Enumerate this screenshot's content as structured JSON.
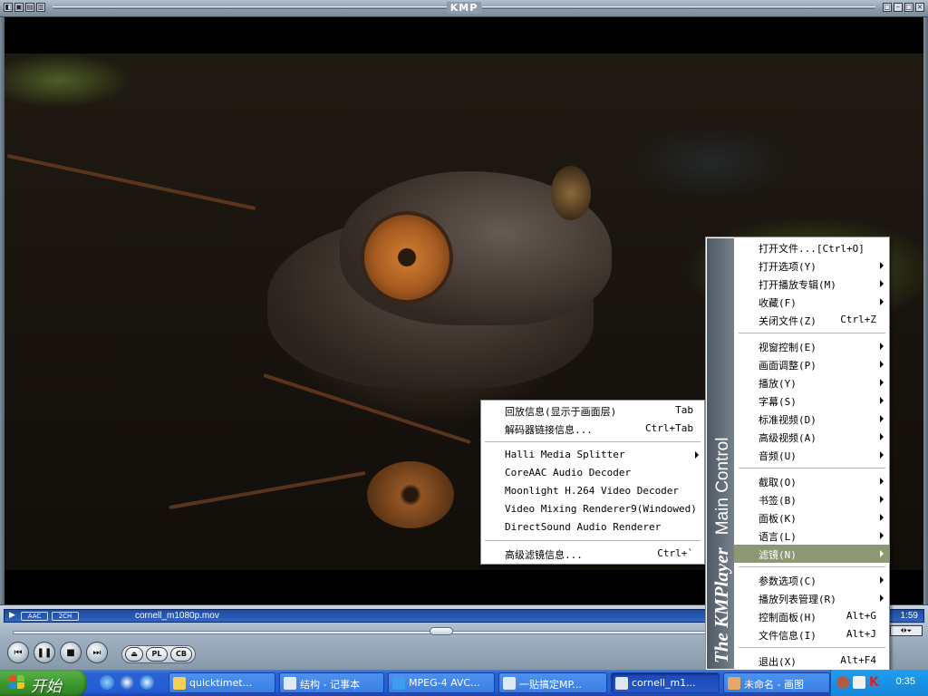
{
  "window": {
    "title": "KMP"
  },
  "status_bar": {
    "audio_codec_badge": "AAC",
    "channel_badge": "2CH",
    "file_name": "cornell_m1080p.mov",
    "time": "1:59"
  },
  "controls": {
    "buttons": [
      "prev-icon",
      "pause-icon",
      "stop-icon",
      "next-icon"
    ],
    "pill_buttons": [
      "PL",
      "CB"
    ],
    "eject_icon": "eject-icon",
    "seek_progress": 0.475
  },
  "main_menu": {
    "strip_brand": "The KMPlayer",
    "strip_title": "Main Control",
    "selected_item": "滤镜",
    "groups": [
      [
        {
          "label": "打开文件...[Ctrl+O]",
          "shortcut": "",
          "submenu": false
        },
        {
          "label": "打开选项(Y)",
          "shortcut": "",
          "submenu": true
        },
        {
          "label": "打开播放专辑(M)",
          "shortcut": "",
          "submenu": true
        },
        {
          "label": "收藏(F)",
          "shortcut": "",
          "submenu": true
        },
        {
          "label": "关闭文件(Z)",
          "shortcut": "Ctrl+Z",
          "submenu": false
        }
      ],
      [
        {
          "label": "视窗控制(E)",
          "shortcut": "",
          "submenu": true
        },
        {
          "label": "画面调整(P)",
          "shortcut": "",
          "submenu": true
        },
        {
          "label": "播放(Y)",
          "shortcut": "",
          "submenu": true
        },
        {
          "label": "字幕(S)",
          "shortcut": "",
          "submenu": true
        },
        {
          "label": "标准视频(D)",
          "shortcut": "",
          "submenu": true
        },
        {
          "label": "高级视频(A)",
          "shortcut": "",
          "submenu": true
        },
        {
          "label": "音频(U)",
          "shortcut": "",
          "submenu": true
        }
      ],
      [
        {
          "label": "截取(O)",
          "shortcut": "",
          "submenu": true
        },
        {
          "label": "书签(B)",
          "shortcut": "",
          "submenu": true
        },
        {
          "label": "面板(K)",
          "shortcut": "",
          "submenu": true
        },
        {
          "label": "语言(L)",
          "shortcut": "",
          "submenu": true
        },
        {
          "label": "滤镜(N)",
          "shortcut": "",
          "submenu": true
        }
      ],
      [
        {
          "label": "参数选项(C)",
          "shortcut": "",
          "submenu": true
        },
        {
          "label": "播放列表管理(R)",
          "shortcut": "",
          "submenu": true
        },
        {
          "label": "控制面板(H)",
          "shortcut": "Alt+G",
          "submenu": false
        },
        {
          "label": "文件信息(I)",
          "shortcut": "Alt+J",
          "submenu": false
        }
      ],
      [
        {
          "label": "退出(X)",
          "shortcut": "Alt+F4",
          "submenu": false
        }
      ]
    ]
  },
  "filter_menu": {
    "groups": [
      [
        {
          "label": "回放信息(显示于画面层)",
          "shortcut": "Tab",
          "submenu": false
        },
        {
          "label": "解码器链接信息...",
          "shortcut": "Ctrl+Tab",
          "submenu": false
        }
      ],
      [
        {
          "label": "Halli Media Splitter",
          "shortcut": "",
          "submenu": true
        },
        {
          "label": "CoreAAC Audio Decoder",
          "shortcut": "",
          "submenu": false
        },
        {
          "label": "Moonlight H.264 Video Decoder",
          "shortcut": "",
          "submenu": false
        },
        {
          "label": "Video Mixing Renderer9(Windowed)",
          "shortcut": "",
          "submenu": false
        },
        {
          "label": "DirectSound Audio Renderer",
          "shortcut": "",
          "submenu": false
        }
      ],
      [
        {
          "label": "高级滤镜信息...",
          "shortcut": "Ctrl+`",
          "submenu": false
        }
      ]
    ]
  },
  "taskbar": {
    "start_label": "开始",
    "quick_launch": [
      "ie-icon",
      "media-player-icon",
      "browser-icon"
    ],
    "tasks": [
      {
        "label": "quicktimet...",
        "icon": "folder-icon",
        "active": false
      },
      {
        "label": "结构 - 记事本",
        "icon": "notepad-icon",
        "active": false
      },
      {
        "label": "MPEG-4 AVC...",
        "icon": "ie-icon",
        "active": false
      },
      {
        "label": "一贴搞定MP...",
        "icon": "notepad-icon",
        "active": false
      },
      {
        "label": "cornell_m1...",
        "icon": "kmplayer-icon",
        "active": true
      },
      {
        "label": "未命名 - 画图",
        "icon": "paint-icon",
        "active": false
      }
    ],
    "clock": "0:35"
  }
}
